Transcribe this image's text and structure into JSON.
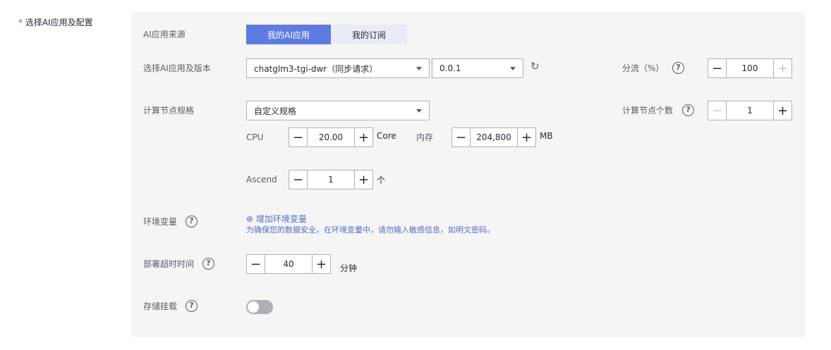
{
  "section": {
    "required_mark": "*",
    "label": "选择AI应用及配置"
  },
  "source": {
    "label": "AI应用来源",
    "options": [
      "我的AI应用",
      "我的订阅"
    ],
    "selected": "我的AI应用"
  },
  "app": {
    "label": "选择AI应用及版本",
    "app_value": "chatglm3-tgi-dwr（同步请求）",
    "version_value": "0.0.1",
    "refresh_icon": "refresh-icon"
  },
  "traffic": {
    "label": "分流（%）",
    "value": "100"
  },
  "spec": {
    "label": "计算节点规格",
    "value": "自定义规格"
  },
  "node_count": {
    "label": "计算节点个数",
    "value": "1"
  },
  "cpu": {
    "label": "CPU",
    "value": "20.00",
    "unit": "Core"
  },
  "memory": {
    "label": "内存",
    "value": "204,800",
    "unit": "MB"
  },
  "ascend": {
    "label": "Ascend",
    "value": "1",
    "unit": "个"
  },
  "env": {
    "label": "环境变量",
    "add_link": "增加环境变量",
    "hint": "为确保您的数据安全，在环境变量中，请勿输入敏感信息，如明文密码。"
  },
  "timeout": {
    "label": "部署超时时间",
    "value": "40",
    "unit": "分钟"
  },
  "storage": {
    "label": "存储挂载",
    "enabled": false
  },
  "icons": {
    "help": "help-icon",
    "minus": "−",
    "plus": "+",
    "add_circle": "⊕",
    "refresh": "↻",
    "help_glyph": "?"
  }
}
